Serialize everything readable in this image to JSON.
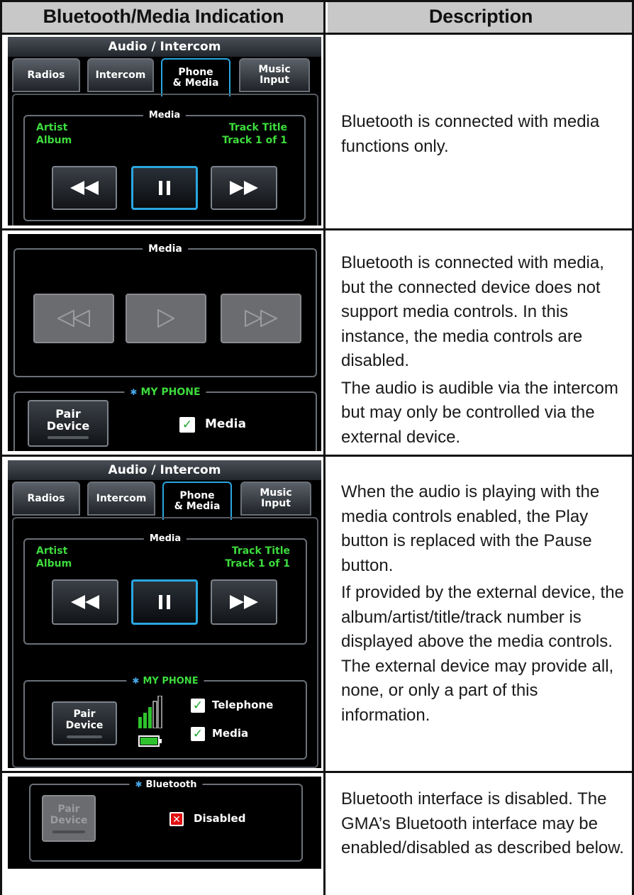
{
  "table": {
    "headers": [
      "Bluetooth/Media Indication",
      "Description"
    ]
  },
  "rows": [
    {
      "screen": {
        "title": "Audio / Intercom",
        "tabs": [
          "Radios",
          "Intercom",
          "Phone\n& Media",
          "Music\nInput"
        ],
        "active_tab": "Phone & Media",
        "media_legend": "Media",
        "artist": "Artist",
        "album": "Album",
        "track_title": "Track Title",
        "track_num": "Track 1 of 1",
        "controls": [
          "rewind-icon",
          "pause-icon",
          "fast-forward-icon"
        ]
      },
      "description": [
        "Bluetooth is connected with media functions only."
      ]
    },
    {
      "screen": {
        "media_legend": "Media",
        "controls_disabled": [
          "rewind-icon",
          "play-icon",
          "fast-forward-icon"
        ],
        "phone_legend": "MY PHONE",
        "pair_button": "Pair\nDevice",
        "checkbox_label": "Media",
        "checkbox_checked": true
      },
      "description": [
        "Bluetooth is connected with media, but the connected device does not support media controls.  In this instance, the media controls are disabled.",
        "The audio is audible via the intercom but may only be controlled via the external device."
      ]
    },
    {
      "screen": {
        "title": "Audio / Intercom",
        "tabs": [
          "Radios",
          "Intercom",
          "Phone\n& Media",
          "Music\nInput"
        ],
        "active_tab": "Phone & Media",
        "media_legend": "Media",
        "artist": "Artist",
        "album": "Album",
        "track_title": "Track Title",
        "track_num": "Track 1 of 1",
        "phone_legend": "MY PHONE",
        "pair_button": "Pair\nDevice",
        "checkbox_1": "Telephone",
        "checkbox_2": "Media",
        "icons": [
          "signal-strength-icon",
          "battery-icon"
        ]
      },
      "description": [
        "When the audio is playing with the media controls enabled, the Play button is replaced with the Pause button.",
        "If provided by the external device, the album/artist/title/track number is displayed above the media controls.  The external device may provide all, none, or only a part of this information."
      ]
    },
    {
      "screen": {
        "legend": "Bluetooth",
        "pair_button": "Pair\nDevice",
        "checkbox_label": "Disabled",
        "checkbox_state": "disabled"
      },
      "description": [
        "Bluetooth interface is disabled.  The GMA’s Bluetooth interface may be enabled/disabled as described below."
      ]
    }
  ],
  "colors": {
    "header_bg": "#c8c8c8",
    "accent_green": "#3ddc3d",
    "selection_blue": "#2aa7e0"
  }
}
